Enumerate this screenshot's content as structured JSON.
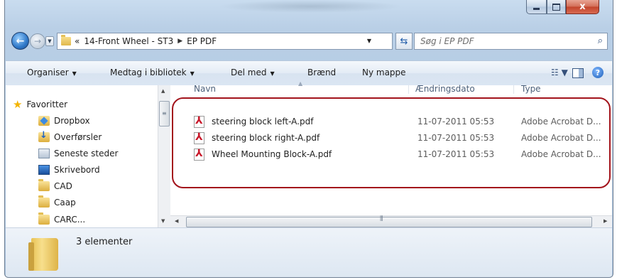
{
  "window": {
    "controls": {
      "minimize_icon": "minimize-icon",
      "maximize_icon": "maximize-icon",
      "close_label": "x"
    }
  },
  "nav": {
    "breadcrumb_prefix": "«",
    "breadcrumb": [
      "14-Front Wheel - ST3",
      "EP PDF"
    ],
    "search_placeholder": "Søg i EP PDF"
  },
  "toolbar": {
    "organize": "Organiser",
    "include": "Medtag i bibliotek",
    "share": "Del med",
    "burn": "Brænd",
    "new_folder": "Ny mappe"
  },
  "sidebar": {
    "items": [
      {
        "label": "Favoritter",
        "icon": "star-icon"
      },
      {
        "label": "Dropbox",
        "icon": "dropbox-folder-icon"
      },
      {
        "label": "Overførsler",
        "icon": "downloads-folder-icon"
      },
      {
        "label": "Seneste steder",
        "icon": "recent-places-icon"
      },
      {
        "label": "Skrivebord",
        "icon": "desktop-icon"
      },
      {
        "label": "CAD",
        "icon": "folder-icon"
      },
      {
        "label": "Caap",
        "icon": "folder-icon"
      },
      {
        "label": "CARC...",
        "icon": "folder-icon"
      }
    ]
  },
  "columns": {
    "name": "Navn",
    "date": "Ændringsdato",
    "type": "Type"
  },
  "files": [
    {
      "name": "steering block left-A.pdf",
      "date": "11-07-2011 05:53",
      "type": "Adobe Acrobat D..."
    },
    {
      "name": "steering block right-A.pdf",
      "date": "11-07-2011 05:53",
      "type": "Adobe Acrobat D..."
    },
    {
      "name": "Wheel Mounting Block-A.pdf",
      "date": "11-07-2011 05:53",
      "type": "Adobe Acrobat D..."
    }
  ],
  "status": {
    "count": "3 elementer"
  },
  "colors": {
    "highlight": "#a3141c",
    "accent": "#2f78c8"
  }
}
